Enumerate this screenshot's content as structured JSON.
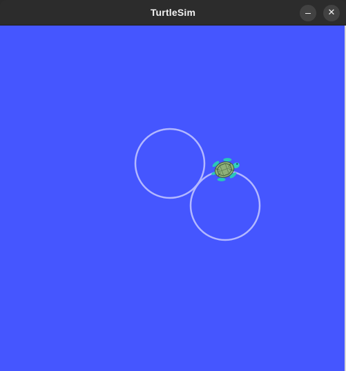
{
  "window": {
    "title": "TurtleSim",
    "minimize_glyph": "",
    "close_glyph": "✕"
  },
  "canvas": {
    "background_color": "#4556ff",
    "pen_color": "#b3b8ff",
    "paths": [
      {
        "name": "circle-path-1",
        "shape": "circle"
      },
      {
        "name": "circle-path-2",
        "shape": "circle"
      }
    ],
    "turtle": {
      "icon": "turtle-icon",
      "shell_color": "#8fb07a",
      "limb_color": "#29c7b8"
    }
  }
}
